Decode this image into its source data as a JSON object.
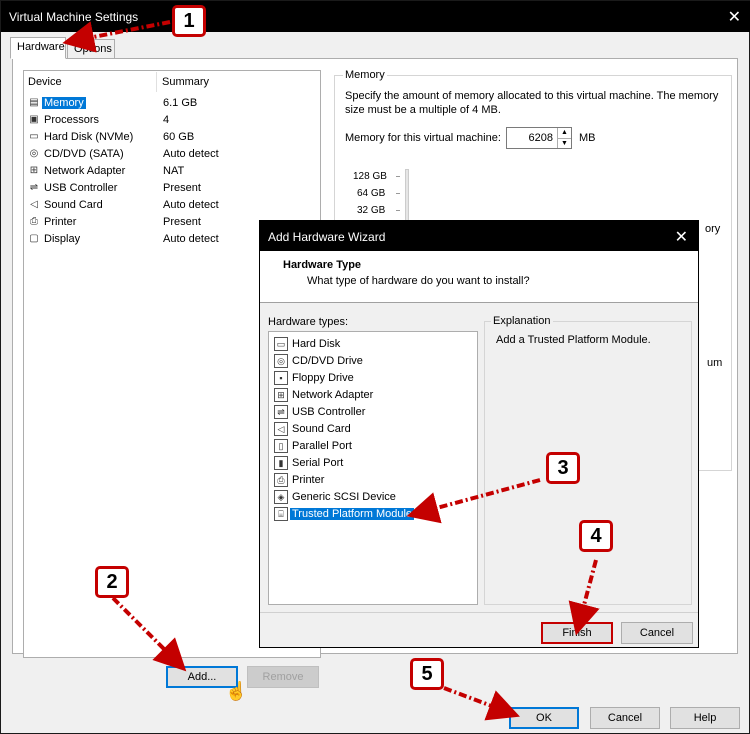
{
  "window": {
    "title": "Virtual Machine Settings",
    "close": "✕"
  },
  "tabs": [
    "Hardware",
    "Options"
  ],
  "device_list": {
    "columns": [
      "Device",
      "Summary"
    ],
    "rows": [
      {
        "icon": "memory-icon",
        "device": "Memory",
        "summary": "6.1 GB",
        "selected": true
      },
      {
        "icon": "processor-icon",
        "device": "Processors",
        "summary": "4"
      },
      {
        "icon": "hard-disk-icon",
        "device": "Hard Disk (NVMe)",
        "summary": "60 GB"
      },
      {
        "icon": "cd-dvd-icon",
        "device": "CD/DVD (SATA)",
        "summary": "Auto detect"
      },
      {
        "icon": "network-adapter-icon",
        "device": "Network Adapter",
        "summary": "NAT"
      },
      {
        "icon": "usb-icon",
        "device": "USB Controller",
        "summary": "Present"
      },
      {
        "icon": "sound-card-icon",
        "device": "Sound Card",
        "summary": "Auto detect"
      },
      {
        "icon": "printer-icon",
        "device": "Printer",
        "summary": "Present"
      },
      {
        "icon": "display-icon",
        "device": "Display",
        "summary": "Auto detect"
      }
    ],
    "add_label": "Add...",
    "remove_label": "Remove"
  },
  "memory": {
    "group_label": "Memory",
    "description": "Specify the amount of memory allocated to this virtual machine. The memory size must be a multiple of 4 MB.",
    "field_label": "Memory for this virtual machine:",
    "value": "6208",
    "unit": "MB",
    "ticks": [
      "128 GB",
      "64 GB",
      "32 GB"
    ],
    "partial_right_1": "ory",
    "partial_right_2": "um"
  },
  "wizard": {
    "title": "Add Hardware Wizard",
    "close": "✕",
    "header_title": "Hardware Type",
    "header_subtitle": "What type of hardware do you want to install?",
    "list_label": "Hardware types:",
    "items": [
      {
        "icon": "hard-disk-icon",
        "label": "Hard Disk"
      },
      {
        "icon": "cd-dvd-icon",
        "label": "CD/DVD Drive"
      },
      {
        "icon": "floppy-icon",
        "label": "Floppy Drive"
      },
      {
        "icon": "network-adapter-icon",
        "label": "Network Adapter"
      },
      {
        "icon": "usb-icon",
        "label": "USB Controller"
      },
      {
        "icon": "sound-card-icon",
        "label": "Sound Card"
      },
      {
        "icon": "parallel-port-icon",
        "label": "Parallel Port"
      },
      {
        "icon": "serial-port-icon",
        "label": "Serial Port"
      },
      {
        "icon": "printer-icon",
        "label": "Printer"
      },
      {
        "icon": "scsi-icon",
        "label": "Generic SCSI Device"
      },
      {
        "icon": "tpm-icon",
        "label": "Trusted Platform Module",
        "selected": true
      }
    ],
    "explanation_label": "Explanation",
    "explanation_text": "Add a Trusted Platform Module.",
    "finish_label": "Finish",
    "cancel_label": "Cancel"
  },
  "footer": {
    "ok_label": "OK",
    "cancel_label": "Cancel",
    "help_label": "Help"
  },
  "callouts": [
    "1",
    "2",
    "3",
    "4",
    "5"
  ],
  "colors": {
    "accent": "#0078d7",
    "callout_red": "#c40000",
    "titlebar": "#000000"
  }
}
